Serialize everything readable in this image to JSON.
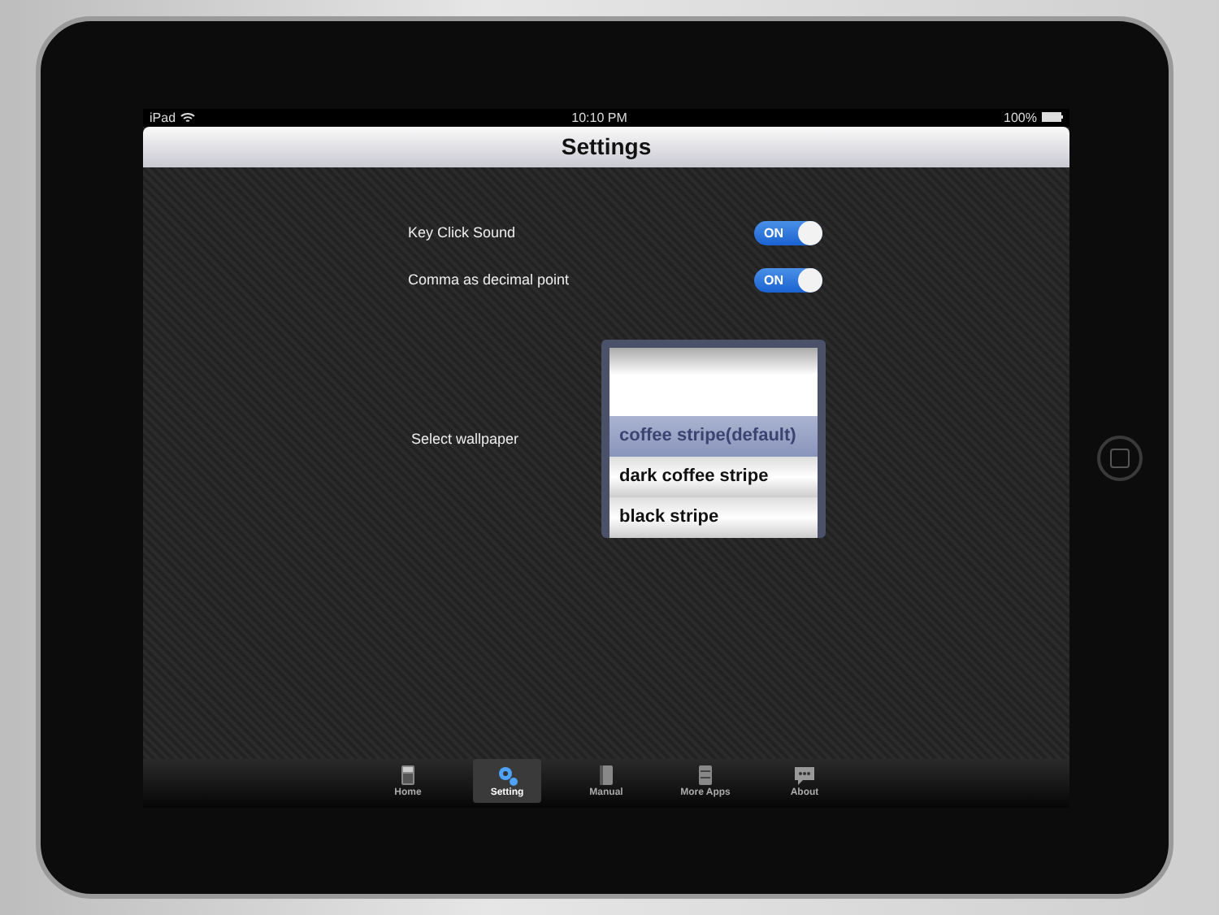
{
  "status_bar": {
    "device": "iPad",
    "time": "10:10 PM",
    "battery": "100%"
  },
  "nav_bar": {
    "title": "Settings"
  },
  "settings": [
    {
      "kind": "toggle",
      "label": "Key Click Sound",
      "on": true,
      "state_label": "ON"
    },
    {
      "kind": "toggle",
      "label": "Comma as decimal point",
      "on": true,
      "state_label": "ON"
    },
    {
      "kind": "picker",
      "label": "Select wallpaper",
      "options": [
        {
          "label": "coffee stripe(default)",
          "selected": true
        },
        {
          "label": "dark coffee stripe",
          "selected": false
        },
        {
          "label": "black stripe",
          "selected": false
        }
      ]
    }
  ],
  "tab_bar": [
    {
      "label": "Home",
      "selected": false
    },
    {
      "label": "Setting",
      "selected": true
    },
    {
      "label": "Manual",
      "selected": false
    },
    {
      "label": "More Apps",
      "selected": false
    },
    {
      "label": "About",
      "selected": false
    }
  ]
}
